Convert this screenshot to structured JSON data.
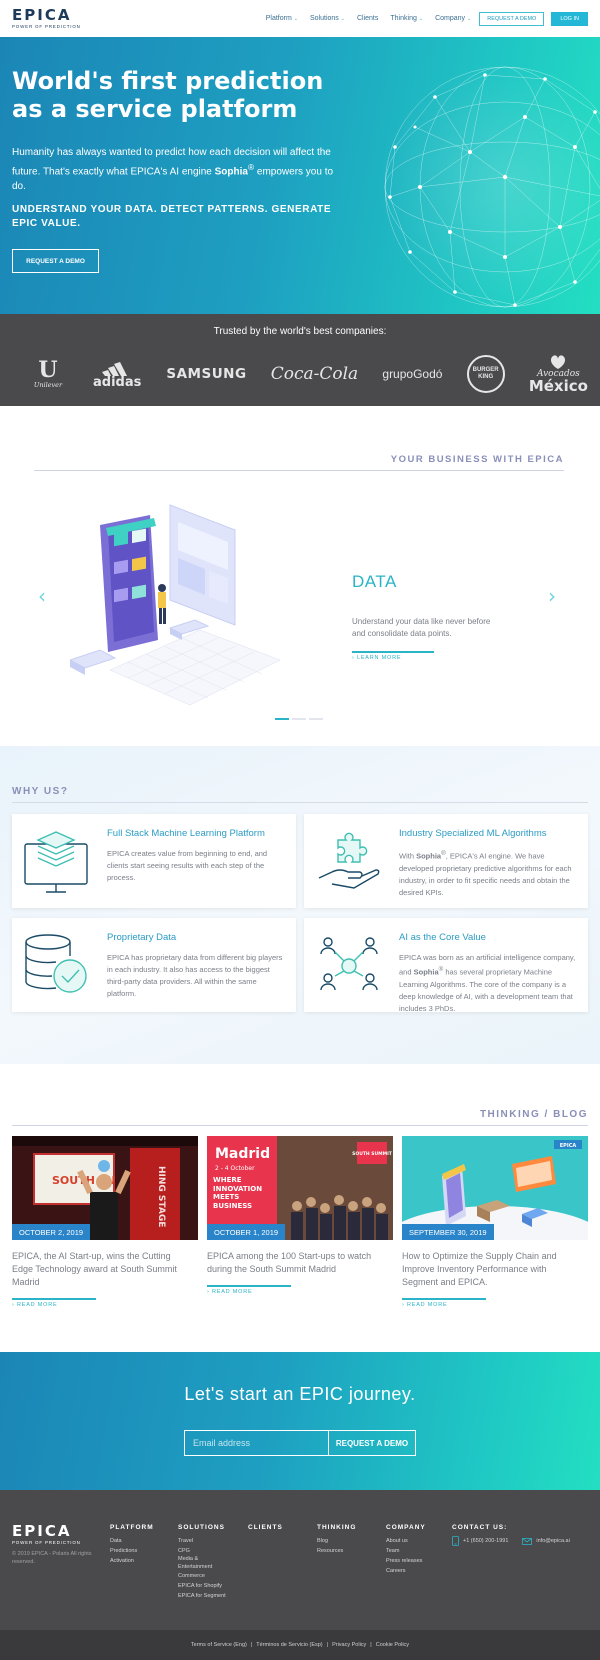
{
  "header": {
    "logo": "EPICA",
    "logo_tagline": "POWER OF PREDICTION",
    "nav": [
      {
        "label": "Platform",
        "dropdown": true
      },
      {
        "label": "Solutions",
        "dropdown": true
      },
      {
        "label": "Clients",
        "dropdown": false
      },
      {
        "label": "Thinking",
        "dropdown": true
      },
      {
        "label": "Company",
        "dropdown": true
      }
    ],
    "request_demo": "REQUEST A DEMO",
    "login": "LOG IN"
  },
  "hero": {
    "title": "World's first prediction as a service platform",
    "subtitle_before": "Humanity has always wanted to predict how each decision will affect the future. That's exactly what EPICA's AI engine ",
    "subtitle_bold": "Sophia",
    "subtitle_sup": "®",
    "subtitle_after": " empowers you to do.",
    "tagline": "UNDERSTAND YOUR DATA. DETECT PATTERNS. GENERATE EPIC VALUE.",
    "cta": "REQUEST A DEMO"
  },
  "trusted": {
    "title": "Trusted by the world's best companies:",
    "logos": [
      "Unilever",
      "adidas",
      "SAMSUNG",
      "Coca-Cola",
      "grupoGodó",
      "BURGER KING",
      "Avocados Mexico"
    ],
    "unilever_mark": "U",
    "unilever_word": "Unilever",
    "adidas_word": "adidas",
    "samsung_word": "SAMSUNG",
    "coke_word": "Coca-Cola",
    "godo_word": "grupoGodó",
    "bk_line1": "BURGER",
    "bk_line2": "KING",
    "avocados_word": "Avocados",
    "mexico_word": "México"
  },
  "business": {
    "heading": "YOUR BUSINESS WITH EPICA",
    "prev_arrow": "‹",
    "next_arrow": "›",
    "slide": {
      "title": "DATA",
      "text": "Understand your data like never before and consolidate data points.",
      "link": "› LEARN MORE"
    },
    "slides_total": 3,
    "active_slide": 1
  },
  "why": {
    "heading": "WHY US?",
    "cards": [
      {
        "title": "Full Stack Machine Learning Platform",
        "text": "EPICA creates value from beginning to end, and clients start seeing results with each step of the process.",
        "icon": "layers-monitor-icon"
      },
      {
        "title": "Industry Specialized ML Algorithms",
        "text_before": "With ",
        "text_bold": "Sophia",
        "text_sup": "®",
        "text_after": ", EPICA's AI engine. We have developed proprietary predictive algorithms for each industry, in order to fit specific needs and obtain the desired KPIs.",
        "icon": "hand-puzzle-icon"
      },
      {
        "title": "Proprietary Data",
        "text": "EPICA has proprietary data from different big players in each industry. It also has access to the biggest third-party data providers. All within the same platform.",
        "icon": "database-check-icon"
      },
      {
        "title": "AI as the Core Value",
        "text_before": "EPICA was born as an artificial intelligence company, and ",
        "text_bold": "Sophia",
        "text_sup": "®",
        "text_after": " has several proprietary Machine Learning Algorithms. The core of the company is a deep knowledge of AI, with a development team that includes 3 PhDs.",
        "icon": "network-people-icon"
      }
    ]
  },
  "blog": {
    "heading": "THINKING / BLOG",
    "posts": [
      {
        "date": "OCTOBER 2, 2019",
        "title": "EPICA, the AI Start-up, wins the Cutting Edge Technology award at South Summit Madrid",
        "link": "› READ MORE"
      },
      {
        "date": "OCTOBER 1, 2019",
        "title": "EPICA among the 100 Start-ups to watch during the South Summit Madrid",
        "link": "› READ MORE"
      },
      {
        "date": "SEPTEMBER 30, 2019",
        "title": "How to Optimize the Supply Chain and Improve Inventory Performance with Segment and EPICA.",
        "link": "› READ MORE"
      }
    ],
    "img1_screen_text": "SOUTH SU",
    "img1_stage_text": "HING STAGE",
    "img2_city": "Madrid",
    "img2_dates": "2 - 4 October",
    "img2_slogan": "WHERE INNOVATION MEETS BUSINESS",
    "img2_badge": "SOUTH SUMMIT",
    "img3_badge": "EPICA"
  },
  "journey": {
    "title": "Let's start an EPIC journey.",
    "email_placeholder": "Email address",
    "button": "REQUEST A DEMO"
  },
  "footer": {
    "logo": "EPICA",
    "logo_tagline": "POWER OF PREDICTION",
    "copyright": "© 2019 EPICA - Polaris All rights reserved.",
    "columns": [
      {
        "title": "PLATFORM",
        "links": [
          "Data",
          "Predictions",
          "Activation"
        ]
      },
      {
        "title": "SOLUTIONS",
        "links": [
          "Travel",
          "CPG",
          "Media &",
          "Entertainment",
          "Commerce",
          "EPICA for Shopify",
          "EPICA for Segment"
        ]
      },
      {
        "title": "CLIENTS",
        "links": []
      },
      {
        "title": "THINKING",
        "links": [
          "Blog",
          "Resources"
        ]
      },
      {
        "title": "COMPANY",
        "links": [
          "About us",
          "Team",
          "Press releases",
          "Careers"
        ]
      }
    ],
    "contact_title": "CONTACT US:",
    "phone": "+1 (650) 200-1991",
    "email": "info@epica.ai",
    "bottom_links": [
      "Terms of Service (Eng)",
      "Términos de Servicio (Esp)",
      "Privacy Policy",
      "Cookie Policy"
    ],
    "separator": "|"
  }
}
